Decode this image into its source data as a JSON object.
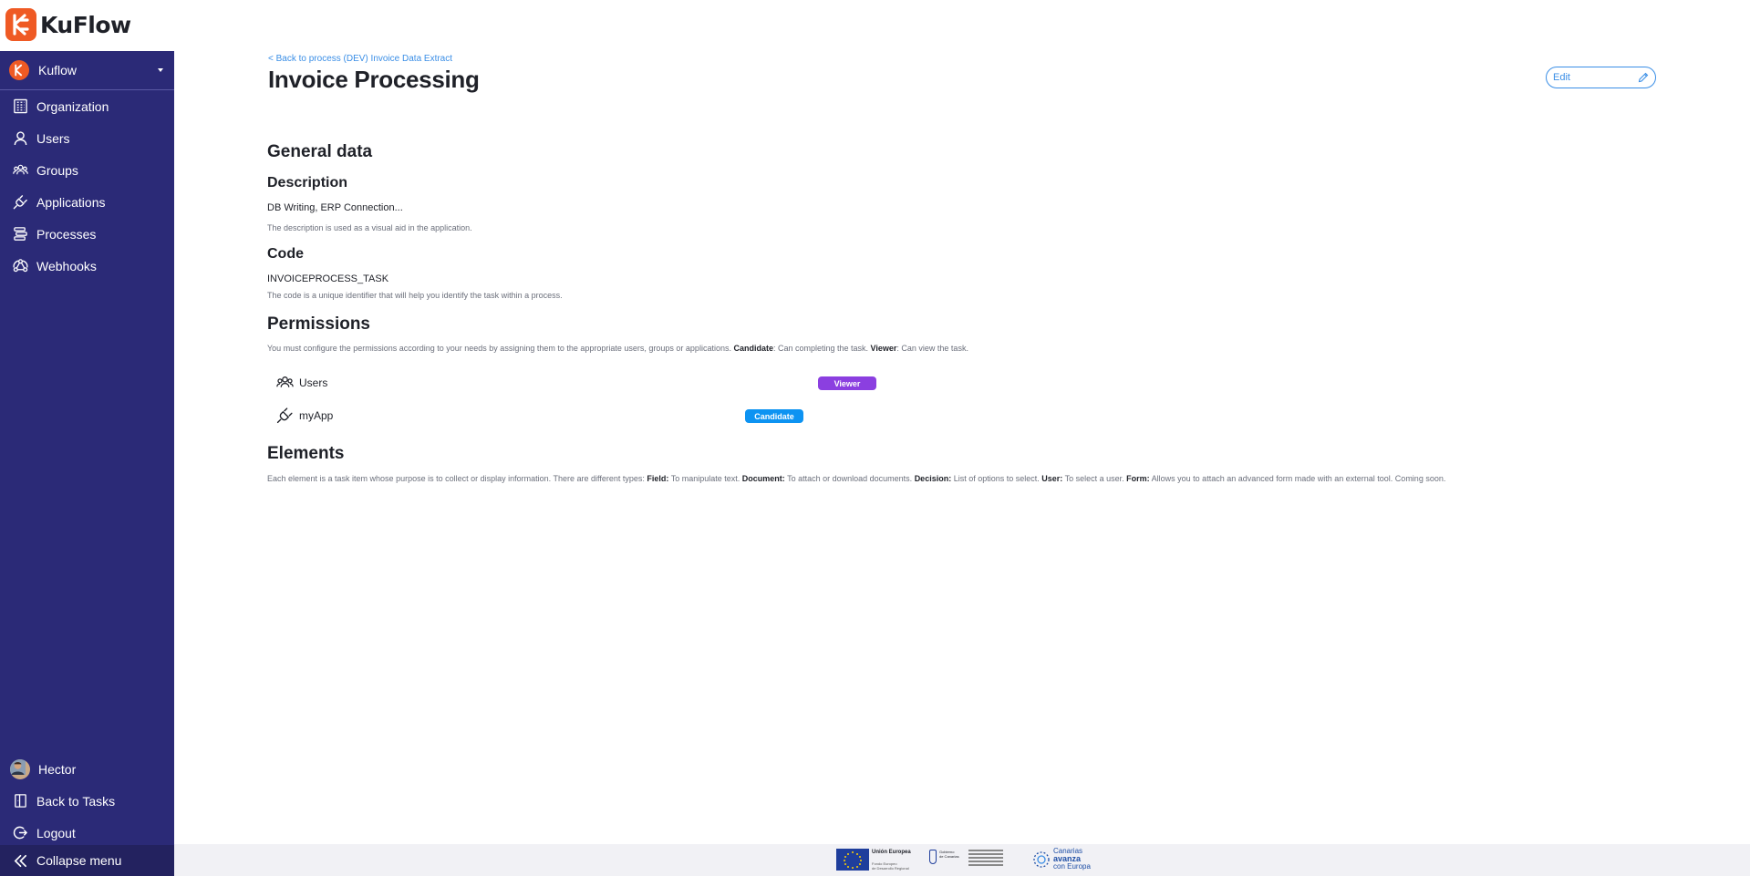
{
  "app": {
    "brand": "KuFlow",
    "accent_color": "#ef5a24",
    "sidebar_color": "#2b2a77",
    "link_color": "#3a8ee6"
  },
  "sidebar": {
    "org_name": "Kuflow",
    "items": [
      {
        "label": "Organization",
        "icon": "building-icon"
      },
      {
        "label": "Users",
        "icon": "user-icon"
      },
      {
        "label": "Groups",
        "icon": "group-icon"
      },
      {
        "label": "Applications",
        "icon": "plug-icon"
      },
      {
        "label": "Processes",
        "icon": "processes-icon"
      },
      {
        "label": "Webhooks",
        "icon": "webhook-icon"
      }
    ],
    "bottom": {
      "user_name": "Hector",
      "back_to_tasks": "Back to Tasks",
      "logout": "Logout",
      "collapse": "Collapse menu"
    }
  },
  "header": {
    "back_link": "< Back to process (DEV) Invoice Data Extract",
    "title": "Invoice Processing",
    "edit_label": "Edit"
  },
  "general": {
    "heading": "General data",
    "description_heading": "Description",
    "description_value": "DB Writing, ERP Connection...",
    "description_help": "The description is used as a visual aid in the application.",
    "code_heading": "Code",
    "code_value": "INVOICEPROCESS_TASK",
    "code_help": "The code is a unique identifier that will help you identify the task within a process."
  },
  "permissions": {
    "heading": "Permissions",
    "help_prefix": "You must configure the permissions according to your needs by assigning them to the appropriate users, groups or applications. ",
    "candidate_label": "Candidate",
    "candidate_desc": ": Can completing the task. ",
    "viewer_label": "Viewer",
    "viewer_desc": ": Can view the task.",
    "rows": [
      {
        "name": "Users",
        "icon": "group-icon",
        "role": "Viewer",
        "role_color": "#8b3fe0"
      },
      {
        "name": "myApp",
        "icon": "plug-icon",
        "role": "Candidate",
        "role_color": "#0d93f2"
      }
    ]
  },
  "elements": {
    "heading": "Elements",
    "help_intro": "Each element is a task item whose purpose is to collect or display information. There are different types: ",
    "field_label": "Field:",
    "field_desc": " To manipulate text. ",
    "document_label": "Document:",
    "document_desc": " To attach or download documents. ",
    "decision_label": "Decision:",
    "decision_desc": " List of options to select. ",
    "user_label": "User:",
    "user_desc": " To select a user. ",
    "form_label": "Form:",
    "form_desc": " Allows you to attach an advanced form made with an external tool. Coming soon."
  },
  "footer": {
    "eu_title": "Unión Europea",
    "eu_sub1": "Fondo Europeo",
    "eu_sub2": "de Desarrollo Regional",
    "gob_line1": "Gobierno",
    "gob_line2": "de Canarias",
    "canarias_line1": "Canarias",
    "canarias_line2": "avanza",
    "canarias_line3": "con Europa"
  }
}
